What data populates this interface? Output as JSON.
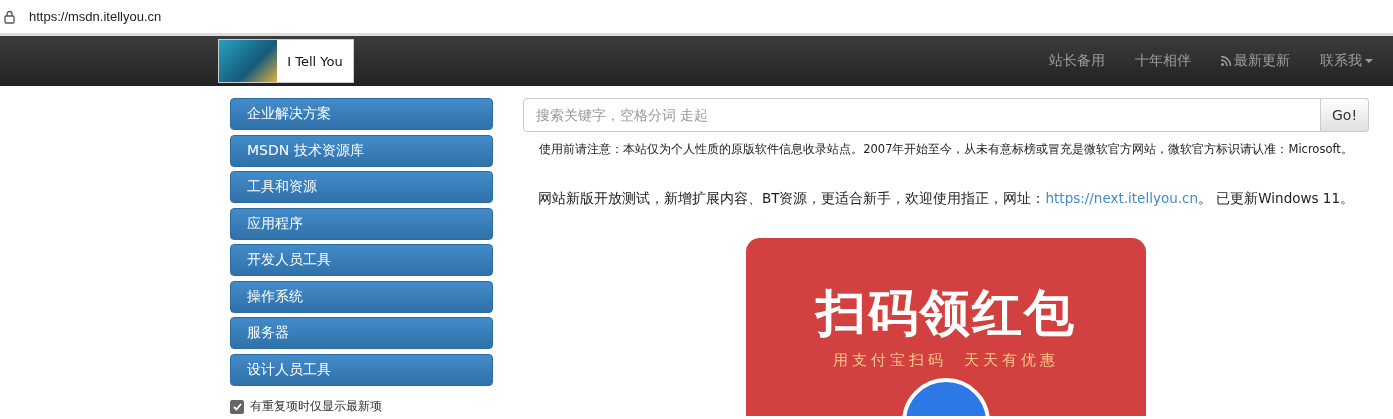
{
  "browser": {
    "url": "https://msdn.itellyou.cn"
  },
  "navbar": {
    "logo_text": "I Tell You",
    "items": [
      {
        "label": "站长备用",
        "kind": "link"
      },
      {
        "label": "十年相伴",
        "kind": "link"
      },
      {
        "label": "最新更新",
        "kind": "rss"
      },
      {
        "label": "联系我",
        "kind": "dropdown"
      }
    ]
  },
  "sidebar": {
    "items": [
      "企业解决方案",
      "MSDN 技术资源库",
      "工具和资源",
      "应用程序",
      "开发人员工具",
      "操作系统",
      "服务器",
      "设计人员工具"
    ],
    "option": {
      "label": "有重复项时仅显示最新项",
      "checked": true
    }
  },
  "search": {
    "placeholder": "搜索关键字，空格分词 走起",
    "button": "Go!"
  },
  "notice": "使用前请注意：本站仅为个人性质的原版软件信息收录站点。2007年开始至今，从未有意标榜或冒充是微软官方网站，微软官方标识请认准：Microsoft。",
  "announcement": {
    "text": "网站新版开放测试，新增扩展内容、BT资源，更适合新手，欢迎使用指正，网址：",
    "link": "https://next.itellyou.cn",
    "after": "。 已更新Windows 11。"
  },
  "banner": {
    "title": "扫码领红包",
    "subtitle": "用支付宝扫码  天天有优惠"
  }
}
